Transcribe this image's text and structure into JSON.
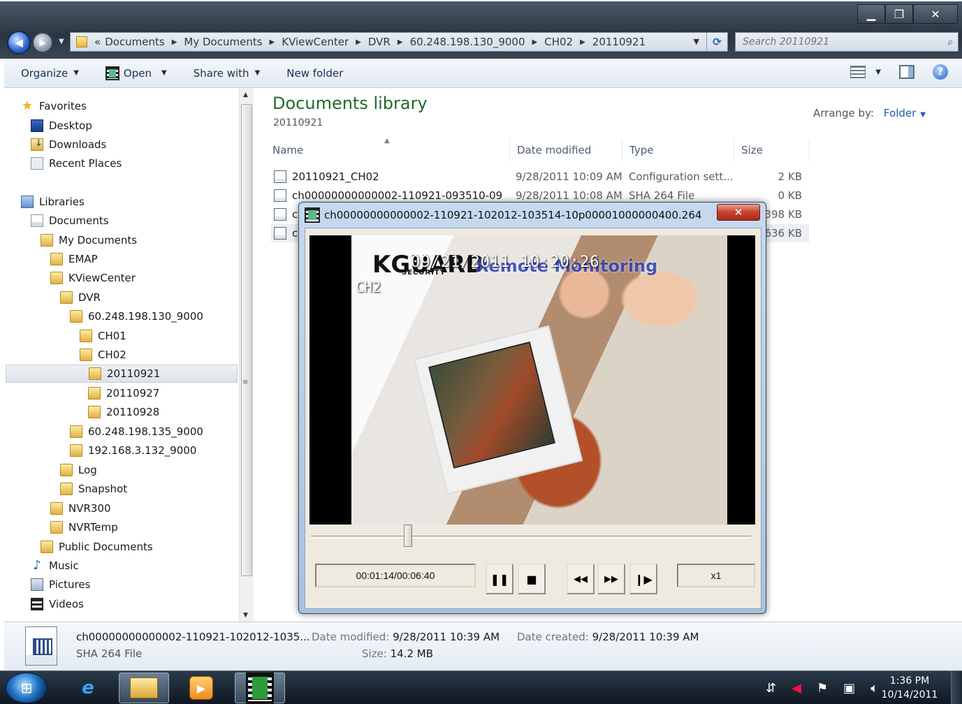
{
  "window": {
    "controls": {
      "minimize": "▁",
      "maximize": "❐",
      "close": "✕"
    }
  },
  "address": {
    "overflow": "«",
    "crumbs": [
      "Documents",
      "My Documents",
      "KViewCenter",
      "DVR",
      "60.248.198.130_9000",
      "CH02",
      "20110921"
    ]
  },
  "search": {
    "placeholder": "Search 20110921"
  },
  "toolbar": {
    "organize": "Organize",
    "open": "Open",
    "share": "Share with",
    "new_folder": "New folder"
  },
  "nav": {
    "items": [
      {
        "label": "Favorites",
        "icon": "star-icon"
      },
      {
        "label": "Desktop",
        "icon": "desktop-icon"
      },
      {
        "label": "Downloads",
        "icon": "downloads-icon"
      },
      {
        "label": "Recent Places",
        "icon": "recent-places-icon"
      },
      {
        "label": "Libraries",
        "icon": "libraries-icon"
      },
      {
        "label": "Documents",
        "icon": "documents-icon"
      },
      {
        "label": "My Documents",
        "icon": "folder-icon"
      },
      {
        "label": "EMAP",
        "icon": "folder-icon"
      },
      {
        "label": "KViewCenter",
        "icon": "folder-icon"
      },
      {
        "label": "DVR",
        "icon": "folder-icon"
      },
      {
        "label": "60.248.198.130_9000",
        "icon": "folder-icon"
      },
      {
        "label": "CH01",
        "icon": "folder-icon"
      },
      {
        "label": "CH02",
        "icon": "folder-icon"
      },
      {
        "label": "20110921",
        "icon": "folder-icon",
        "selected": true
      },
      {
        "label": "20110927",
        "icon": "folder-icon"
      },
      {
        "label": "20110928",
        "icon": "folder-icon"
      },
      {
        "label": "60.248.198.135_9000",
        "icon": "folder-icon"
      },
      {
        "label": "192.168.3.132_9000",
        "icon": "folder-icon"
      },
      {
        "label": "Log",
        "icon": "folder-icon"
      },
      {
        "label": "Snapshot",
        "icon": "folder-icon"
      },
      {
        "label": "NVR300",
        "icon": "folder-icon"
      },
      {
        "label": "NVRTemp",
        "icon": "folder-icon"
      },
      {
        "label": "Public Documents",
        "icon": "folder-icon"
      },
      {
        "label": "Music",
        "icon": "music-icon"
      },
      {
        "label": "Pictures",
        "icon": "pictures-icon"
      },
      {
        "label": "Videos",
        "icon": "videos-icon"
      }
    ]
  },
  "library": {
    "title": "Documents library",
    "subtitle": "20110921",
    "arrange_label": "Arrange by:",
    "arrange_value": "Folder"
  },
  "columns": {
    "name": "Name",
    "date": "Date modified",
    "type": "Type",
    "size": "Size"
  },
  "files": [
    {
      "name": "20110921_CH02",
      "date": "9/28/2011 10:09 AM",
      "type": "Configuration sett...",
      "size": "2 KB"
    },
    {
      "name": "ch00000000000002-110921-093510-09501...",
      "date": "9/28/2011 10:08 AM",
      "type": "SHA 264 File",
      "size": "0 KB"
    },
    {
      "name": "c",
      "date": "",
      "type": "",
      "size": "398 KB"
    },
    {
      "name": "c",
      "date": "",
      "type": "",
      "size": "636 KB"
    }
  ],
  "player": {
    "title": "ch00000000000002-110921-102012-103514-10p00001000000400.264",
    "close": "✕",
    "osd_date": "09/21/2011 10:20:26",
    "osd_brand": "KGUARD",
    "osd_brand_sub": "SECURITY",
    "osd_channel": "CH2",
    "osd_caption": "Remote Monitoring",
    "progress": 0.22,
    "timecode": "00:01:14/00:06:40",
    "speed": "x1",
    "buttons": {
      "pause": "❚❚",
      "stop": "■",
      "rewind": "◀◀",
      "forward": "▶▶",
      "step": "❙▶"
    }
  },
  "details": {
    "name": "ch00000000000002-110921-102012-1035...",
    "type": "SHA 264 File",
    "modified_label": "Date modified:",
    "modified_value": "9/28/2011 10:39 AM",
    "size_label": "Size:",
    "size_value": "14.2 MB",
    "created_label": "Date created:",
    "created_value": "9/28/2011 10:39 AM"
  },
  "taskbar": {
    "clock_time": "1:36 PM",
    "clock_date": "10/14/2011"
  }
}
